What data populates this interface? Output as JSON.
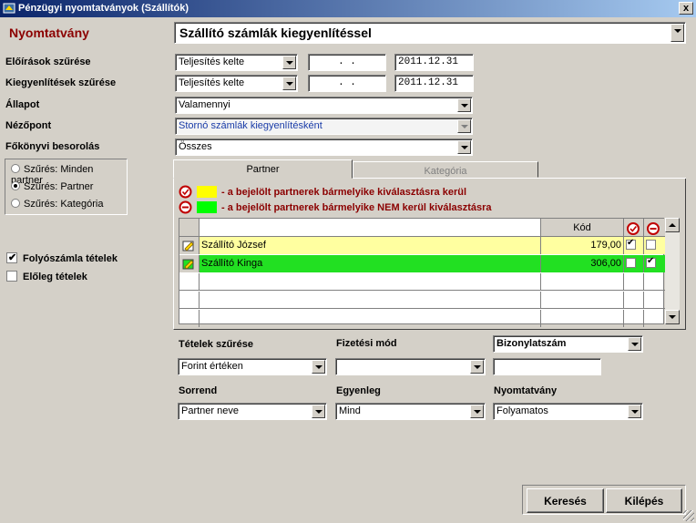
{
  "window": {
    "title": "Pénzügyi nyomtatványok (Szállítók)",
    "close_glyph": "x"
  },
  "header": {
    "label": "Nyomtatvány",
    "selected": "Szállító számlák kiegyenlítéssel"
  },
  "filters": {
    "eloirasok": {
      "label": "Előírások szűrése",
      "type": "Teljesítés kelte",
      "date_from": " .  . ",
      "date_to": "2011.12.31"
    },
    "kiegyenlitesek": {
      "label": "Kiegyenlítések szűrése",
      "type": "Teljesítés kelte",
      "date_from": " .  . ",
      "date_to": "2011.12.31"
    },
    "allapot": {
      "label": "Állapot",
      "value": "Valamennyi"
    },
    "nezopont": {
      "label": "Nézőpont",
      "value": "Stornó számlák kiegyenlítésként"
    },
    "fokonyvi": {
      "label": "Főkönyvi besorolás",
      "value": "Összes"
    }
  },
  "radios": [
    {
      "label": "Szűrés: Minden partner",
      "checked": false
    },
    {
      "label": "Szűrés: Partner",
      "checked": true
    },
    {
      "label": "Szűrés: Kategória",
      "checked": false
    }
  ],
  "checkboxes": {
    "folyoszamla": {
      "label": "Folyószámla tételek",
      "checked": true
    },
    "eloleg": {
      "label": "Előleg tételek",
      "checked": false
    }
  },
  "tabs": {
    "partner": "Partner",
    "kategoria": "Kategória"
  },
  "legend": {
    "include": {
      "text": "- a bejelölt partnerek bármelyike kiválasztásra kerül",
      "color": "#ffff00"
    },
    "exclude": {
      "text": "- a bejelölt partnerek bármelyike NEM kerül kiválasztásra",
      "color": "#00ff00"
    }
  },
  "grid": {
    "headers": {
      "name": "",
      "kod": "Kód"
    },
    "rows": [
      {
        "name": "Szállító József",
        "kod": "179,00",
        "include": true,
        "exclude": false,
        "color": "#ffffa0"
      },
      {
        "name": "Szállító Kinga",
        "kod": "306,00",
        "include": false,
        "exclude": true,
        "color": "#22e022"
      }
    ]
  },
  "bottom": {
    "tetelek": {
      "label": "Tételek szűrése",
      "value": "Forint értéken"
    },
    "fizetesi": {
      "label": "Fizetési mód",
      "value": ""
    },
    "bizonylat": {
      "label": "Bizonylatszám",
      "value": ""
    },
    "sorrend": {
      "label": "Sorrend",
      "value": "Partner neve"
    },
    "egyenleg": {
      "label": "Egyenleg",
      "value": "Mind"
    },
    "nyomtatvany": {
      "label": "Nyomtatvány",
      "value": "Folyamatos"
    }
  },
  "buttons": {
    "search": "Keresés",
    "exit": "Kilépés"
  }
}
